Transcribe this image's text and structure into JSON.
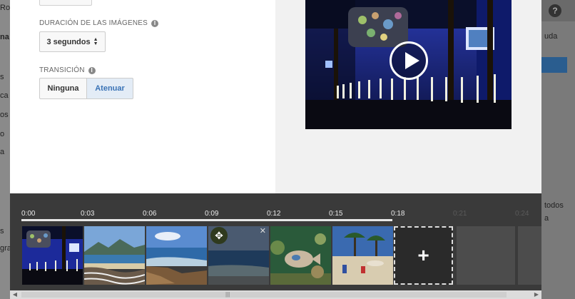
{
  "background": {
    "left_fragments": [
      "Ro",
      "na",
      "s",
      "ca",
      "os",
      "o",
      "a",
      "s",
      "gra"
    ],
    "right_fragments": [
      "uda",
      "todos",
      "a"
    ],
    "help_badge": "?"
  },
  "settings": {
    "duration_label": "DURACIÓN DE LAS IMÁGENES",
    "duration_value": "3 segundos",
    "transition_label": "TRANSICIÓN",
    "transitions": [
      "Ninguna",
      "Atenuar"
    ],
    "selected_transition": "Atenuar",
    "info_icon": "i"
  },
  "timeline": {
    "ticks": [
      "0:00",
      "0:03",
      "0:06",
      "0:09",
      "0:12",
      "0:15",
      "0:18",
      "0:21",
      "0:24"
    ],
    "add_label": "+",
    "close_glyph": "✕",
    "move_glyph": "✥"
  },
  "colors": {
    "accent": "#3a73b6",
    "timeline_bg": "#3a3a3a"
  }
}
